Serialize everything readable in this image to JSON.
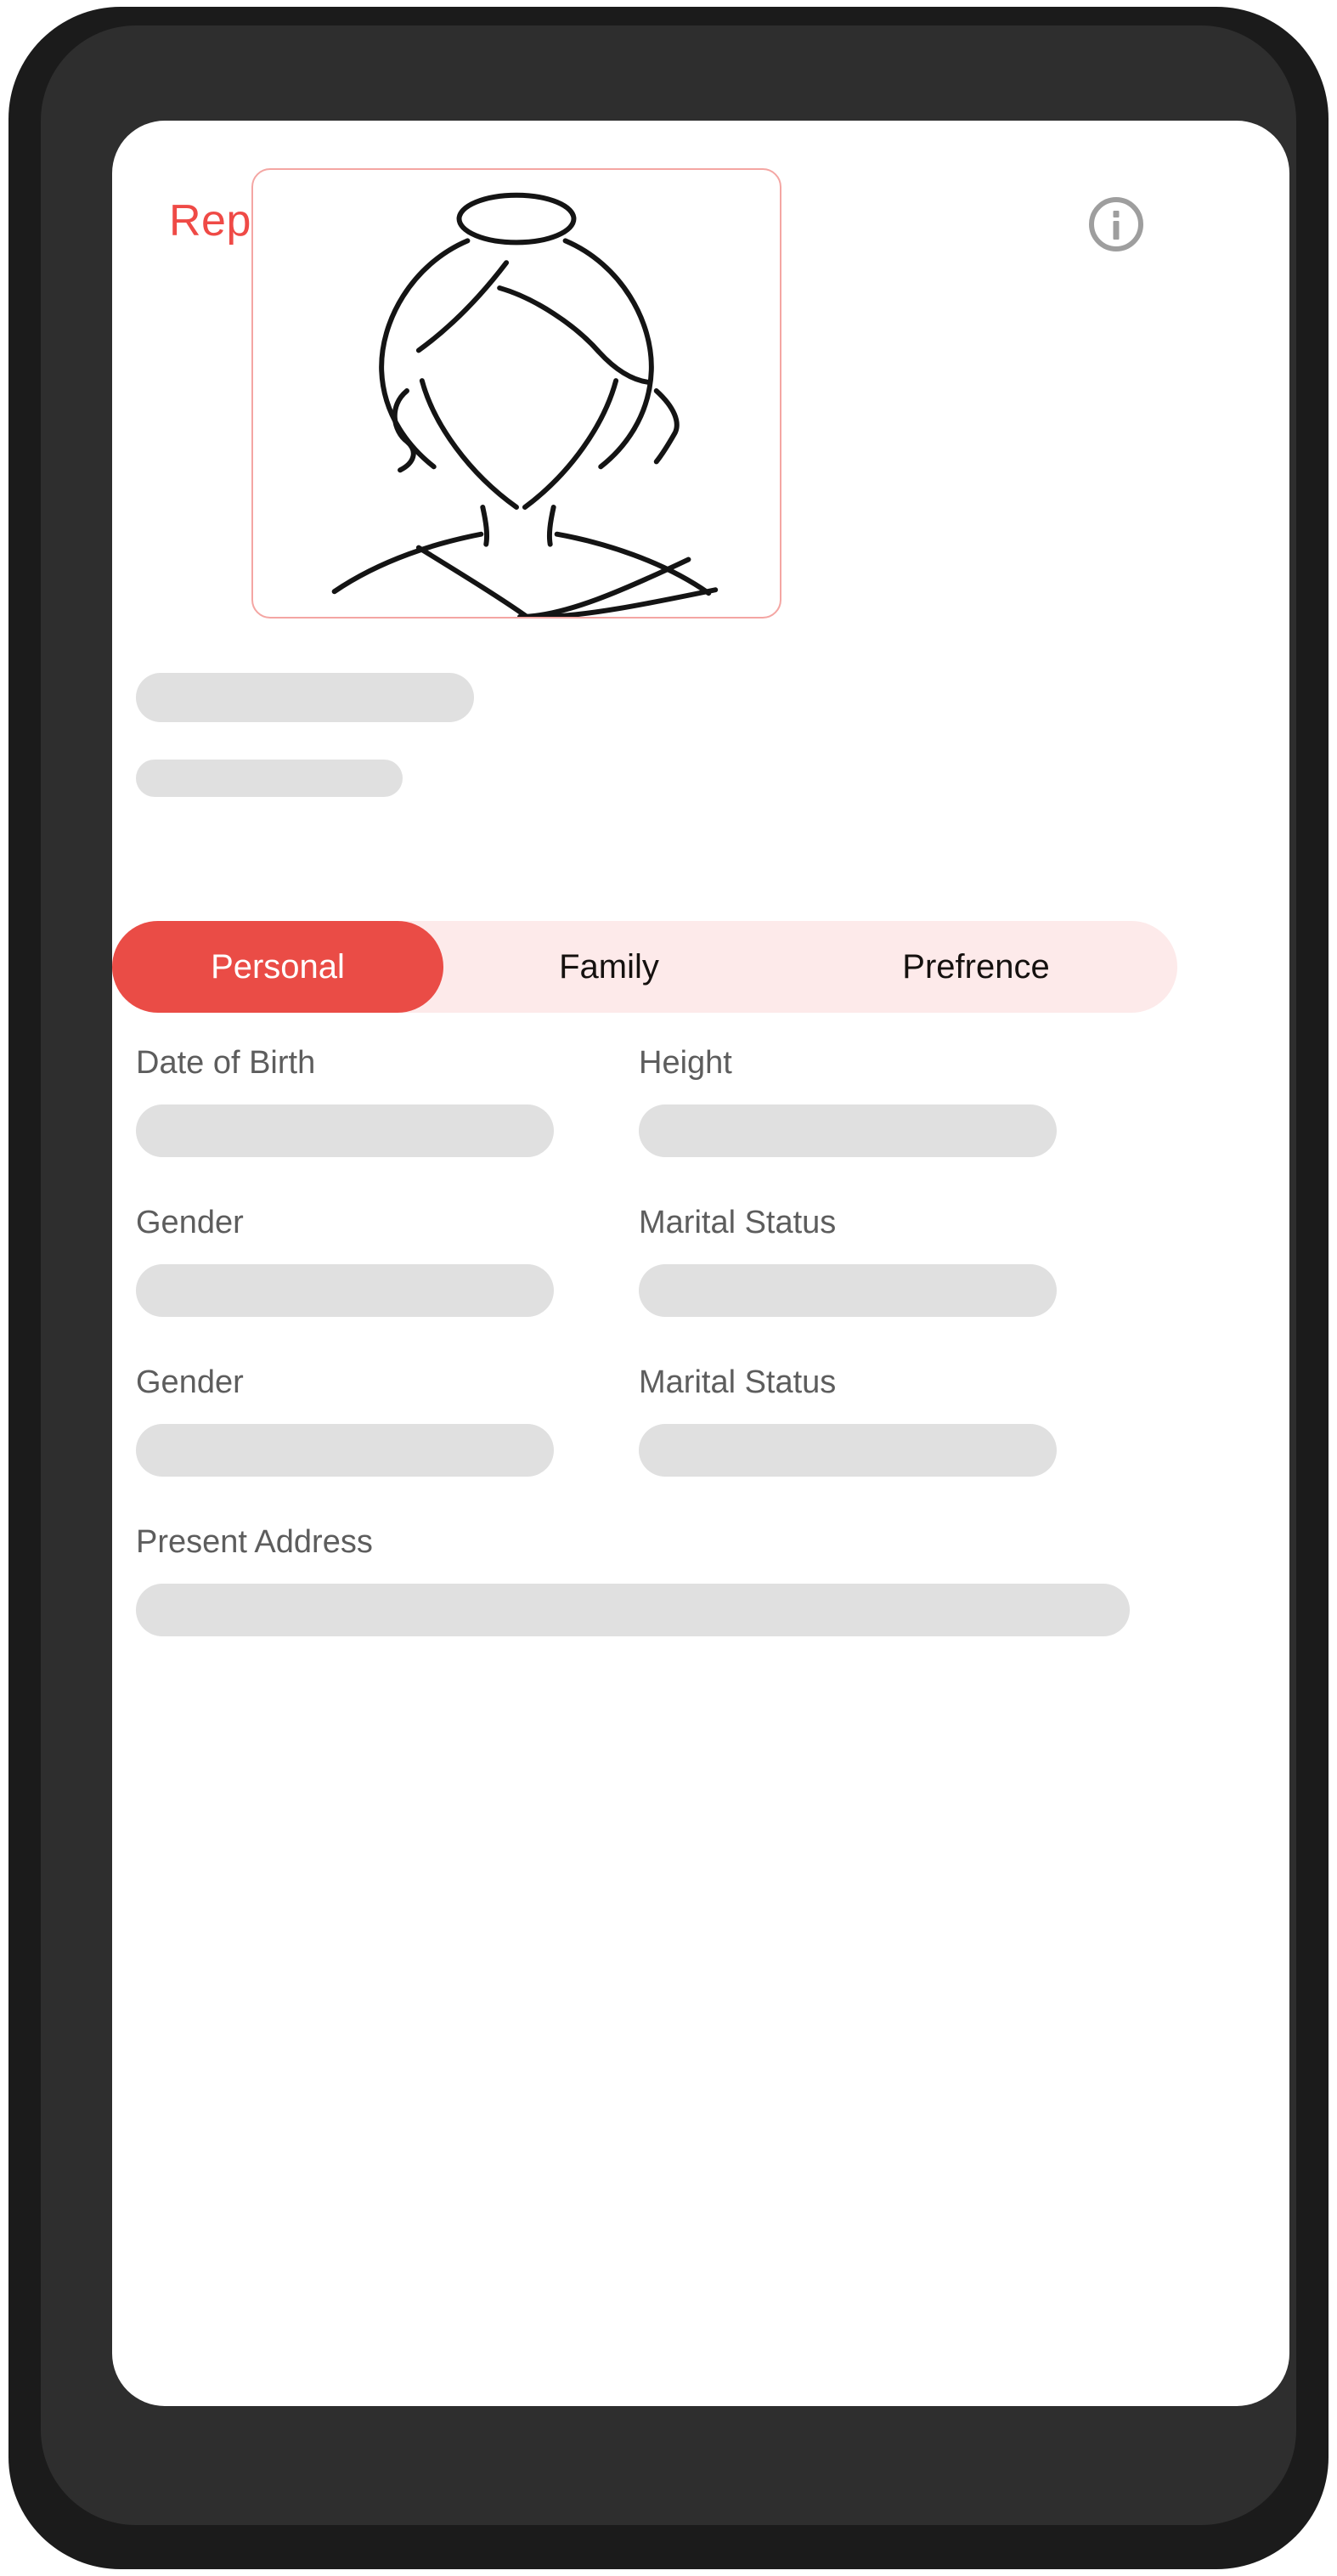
{
  "colors": {
    "accent": "#ef4a46",
    "accent_pill": "#ea4c46",
    "tab_track": "#fdeaea",
    "skeleton": "#e0e0e0",
    "label_text": "#5d5d5d",
    "frame_border": "#f4a6a3",
    "device_outer": "#1b1b1b",
    "device_inner": "#2e2e2e",
    "info_icon": "#9e9e9e"
  },
  "header": {
    "title": "Report",
    "info_icon": "info-circle-icon"
  },
  "profile": {
    "avatar_icon": "female-portrait-line-art",
    "name_placeholder": "",
    "subtitle_placeholder": ""
  },
  "tabs": [
    {
      "label": "Personal",
      "active": true
    },
    {
      "label": "Family",
      "active": false
    },
    {
      "label": "Prefrence",
      "active": false
    }
  ],
  "form": {
    "rows": [
      {
        "left": {
          "label": "Date of Birth",
          "value": ""
        },
        "right": {
          "label": "Height",
          "value": ""
        }
      },
      {
        "left": {
          "label": "Gender",
          "value": ""
        },
        "right": {
          "label": "Marital Status",
          "value": ""
        }
      },
      {
        "left": {
          "label": "Gender",
          "value": ""
        },
        "right": {
          "label": "Marital Status",
          "value": ""
        }
      }
    ],
    "full_row": {
      "label": "Present Address",
      "value": ""
    }
  }
}
